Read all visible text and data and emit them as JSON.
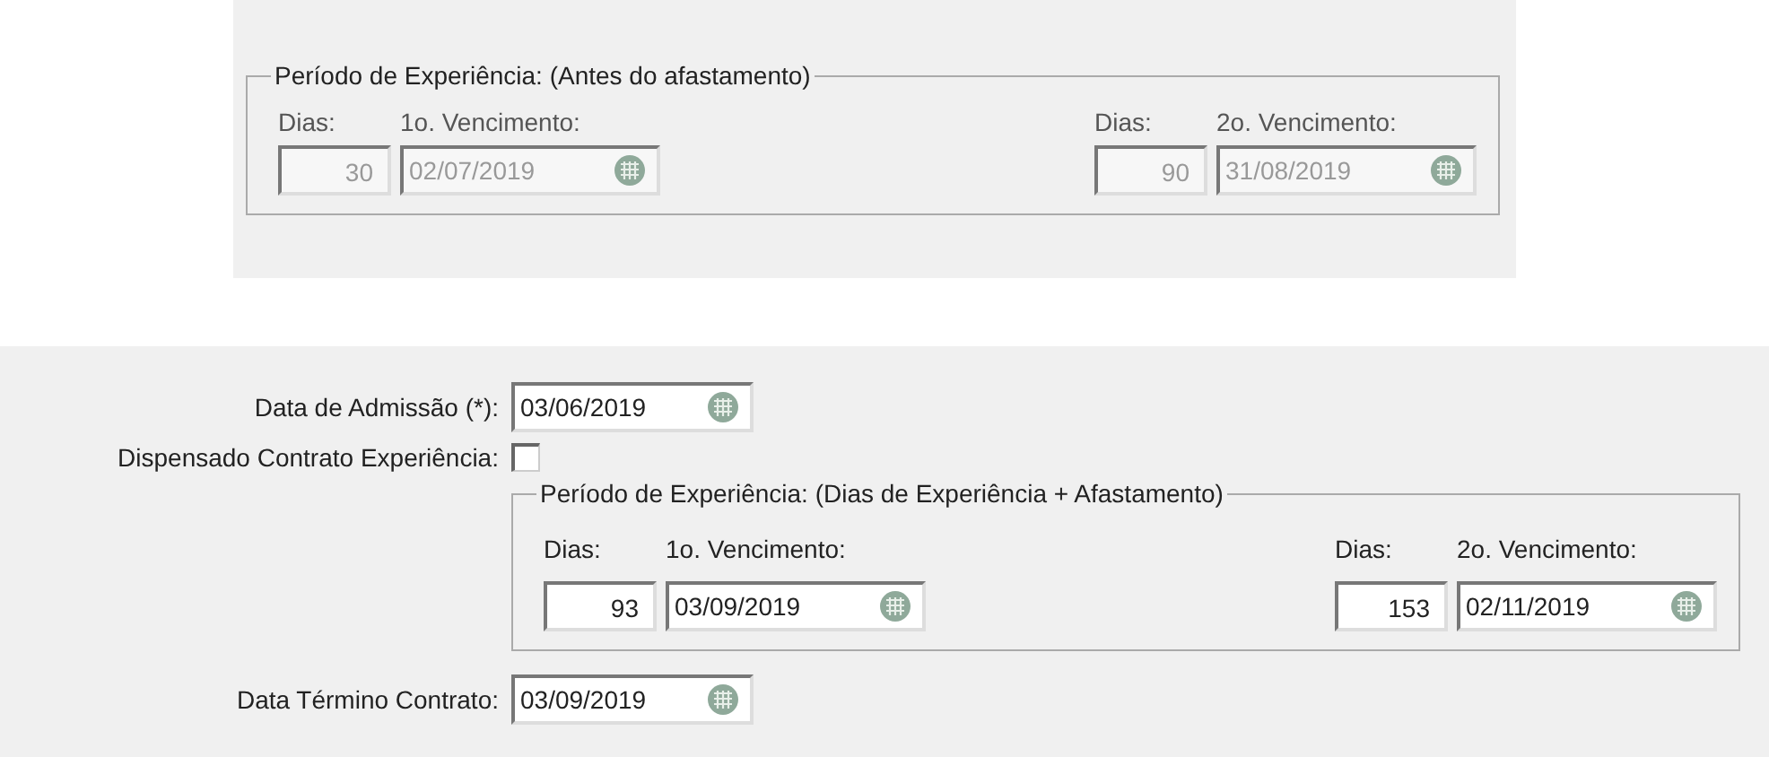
{
  "top_panel": {
    "group": {
      "title": "Período de Experiência: (Antes do afastamento)",
      "disabled": true,
      "periods": [
        {
          "days_label": "Dias:",
          "days": "30",
          "due_label": "1o. Vencimento:",
          "due": "02/07/2019"
        },
        {
          "days_label": "Dias:",
          "days": "90",
          "due_label": "2o. Vencimento:",
          "due": "31/08/2019"
        }
      ]
    }
  },
  "form": {
    "admission": {
      "label": "Data de Admissão (*):",
      "value": "03/06/2019"
    },
    "waived": {
      "label": "Dispensado Contrato Experiência:",
      "checked": false
    },
    "group": {
      "title": "Período de Experiência: (Dias de Experiência + Afastamento)",
      "disabled": false,
      "periods": [
        {
          "days_label": "Dias:",
          "days": "93",
          "due_label": "1o. Vencimento:",
          "due": "03/09/2019"
        },
        {
          "days_label": "Dias:",
          "days": "153",
          "due_label": "2o. Vencimento:",
          "due": "02/11/2019"
        }
      ]
    },
    "end_date": {
      "label": "Data Término Contrato:",
      "value": "03/09/2019"
    }
  }
}
